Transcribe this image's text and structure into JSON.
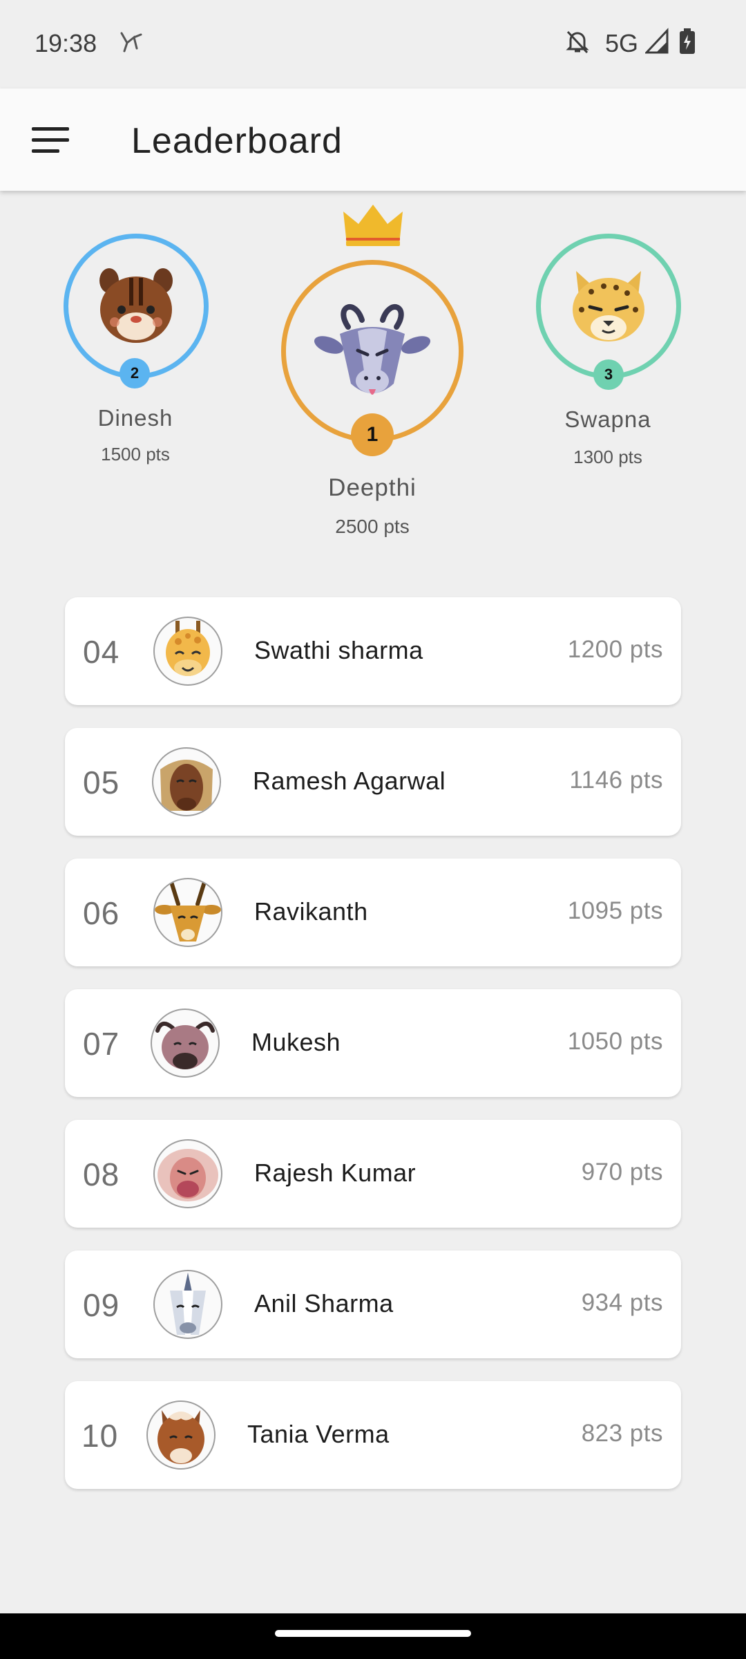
{
  "status_bar": {
    "time": "19:38",
    "network": "5G",
    "icons": [
      "activity-icon",
      "notifications-off-icon",
      "signal-icon",
      "battery-charging-icon"
    ]
  },
  "app_bar": {
    "title": "Leaderboard",
    "menu_icon": "hamburger-menu-icon"
  },
  "podium": {
    "first": {
      "rank": "1",
      "name": "Deepthi",
      "points": "2500 pts",
      "avatar": "goat-icon",
      "ring_color": "#e8a23c"
    },
    "second": {
      "rank": "2",
      "name": "Dinesh",
      "points": "1500 pts",
      "avatar": "chipmunk-icon",
      "ring_color": "#5bb4f0"
    },
    "third": {
      "rank": "3",
      "name": "Swapna",
      "points": "1300 pts",
      "avatar": "cheetah-icon",
      "ring_color": "#6fd1b0"
    },
    "crown_icon": "crown-icon",
    "crown_color": "#f0b92c"
  },
  "leaderboard": [
    {
      "rank": "04",
      "name": "Swathi sharma",
      "points": "1200 pts",
      "avatar": "giraffe-icon"
    },
    {
      "rank": "05",
      "name": "Ramesh Agarwal",
      "points": "1146 pts",
      "avatar": "musk-ox-icon"
    },
    {
      "rank": "06",
      "name": "Ravikanth",
      "points": "1095 pts",
      "avatar": "antelope-icon"
    },
    {
      "rank": "07",
      "name": "Mukesh",
      "points": "1050 pts",
      "avatar": "buffalo-icon"
    },
    {
      "rank": "08",
      "name": "Rajesh Kumar",
      "points": "970 pts",
      "avatar": "baboon-icon"
    },
    {
      "rank": "09",
      "name": "Anil Sharma",
      "points": "934 pts",
      "avatar": "unicorn-icon"
    },
    {
      "rank": "10",
      "name": "Tania Verma",
      "points": "823 pts",
      "avatar": "horse-icon"
    }
  ]
}
